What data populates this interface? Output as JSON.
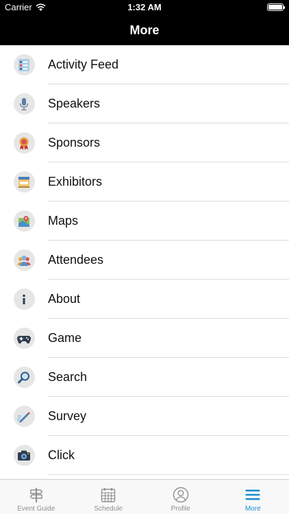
{
  "status_bar": {
    "carrier": "Carrier",
    "time": "1:32 AM"
  },
  "nav": {
    "title": "More"
  },
  "menu": [
    {
      "label": "Activity Feed",
      "icon": "activity-feed-icon"
    },
    {
      "label": "Speakers",
      "icon": "microphone-icon"
    },
    {
      "label": "Sponsors",
      "icon": "ribbon-award-icon"
    },
    {
      "label": "Exhibitors",
      "icon": "booth-icon"
    },
    {
      "label": "Maps",
      "icon": "map-icon"
    },
    {
      "label": "Attendees",
      "icon": "people-icon"
    },
    {
      "label": "About",
      "icon": "info-icon"
    },
    {
      "label": "Game",
      "icon": "gamepad-icon"
    },
    {
      "label": "Search",
      "icon": "magnifier-icon"
    },
    {
      "label": "Survey",
      "icon": "pencil-icon"
    },
    {
      "label": "Click",
      "icon": "camera-icon"
    }
  ],
  "tabs": [
    {
      "label": "Event Guide",
      "icon": "signpost-icon",
      "active": false
    },
    {
      "label": "Schedule",
      "icon": "calendar-icon",
      "active": false
    },
    {
      "label": "Profile",
      "icon": "person-icon",
      "active": false
    },
    {
      "label": "More",
      "icon": "menu-icon",
      "active": true
    }
  ],
  "colors": {
    "accent": "#1a8fce",
    "bar": "#000000",
    "inactive": "#8e8e93"
  }
}
